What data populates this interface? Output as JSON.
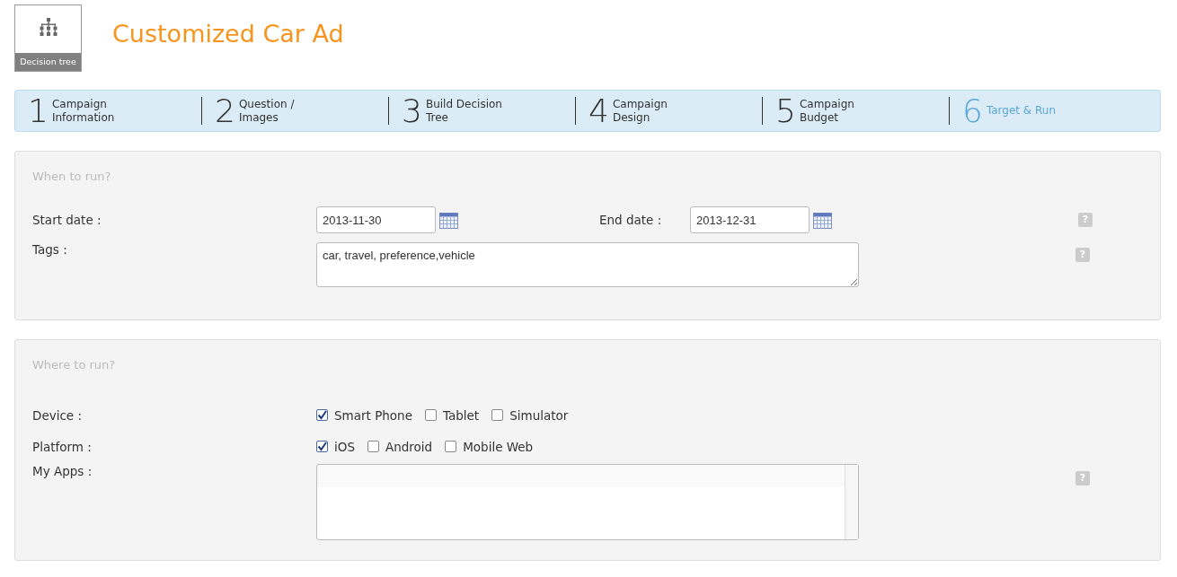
{
  "header": {
    "logo_label": "Decision tree",
    "title": "Customized Car Ad"
  },
  "steps": [
    {
      "number": "1",
      "label": "Campaign Information",
      "selected": false
    },
    {
      "number": "2",
      "label": "Question / Images",
      "selected": false
    },
    {
      "number": "3",
      "label": "Build Decision Tree",
      "selected": false
    },
    {
      "number": "4",
      "label": "Campaign Design",
      "selected": false
    },
    {
      "number": "5",
      "label": "Campaign Budget",
      "selected": false
    },
    {
      "number": "6",
      "label": "Target & Run",
      "selected": true
    }
  ],
  "when": {
    "heading": "When to run?",
    "start_label": "Start date :",
    "start_value": "2013-11-30",
    "end_label": "End date :",
    "end_value": "2013-12-31",
    "dates_help": "?",
    "tags_label": "Tags :",
    "tags_value": "car, travel, preference,vehicle",
    "tags_help": "?"
  },
  "where": {
    "heading": "Where to run?",
    "groups": [
      {
        "label": "Device :",
        "options": [
          {
            "label": "Smart Phone",
            "checked": true
          },
          {
            "label": "Tablet",
            "checked": false
          },
          {
            "label": "Simulator",
            "checked": false
          }
        ]
      },
      {
        "label": "Platform :",
        "options": [
          {
            "label": "iOS",
            "checked": true
          },
          {
            "label": "Android",
            "checked": false
          },
          {
            "label": "Mobile Web",
            "checked": false
          }
        ]
      }
    ],
    "apps_label": "My Apps :",
    "apps_help": "?"
  }
}
